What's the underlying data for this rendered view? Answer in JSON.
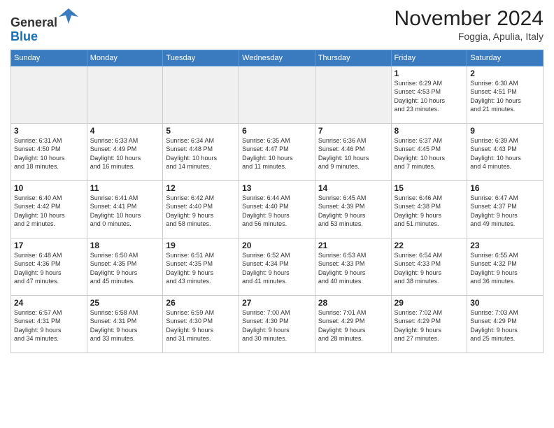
{
  "header": {
    "logo_line1": "General",
    "logo_line2": "Blue",
    "month_title": "November 2024",
    "location": "Foggia, Apulia, Italy"
  },
  "calendar": {
    "weekdays": [
      "Sunday",
      "Monday",
      "Tuesday",
      "Wednesday",
      "Thursday",
      "Friday",
      "Saturday"
    ],
    "weeks": [
      [
        {
          "day": "",
          "info": ""
        },
        {
          "day": "",
          "info": ""
        },
        {
          "day": "",
          "info": ""
        },
        {
          "day": "",
          "info": ""
        },
        {
          "day": "",
          "info": ""
        },
        {
          "day": "1",
          "info": "Sunrise: 6:29 AM\nSunset: 4:53 PM\nDaylight: 10 hours\nand 23 minutes."
        },
        {
          "day": "2",
          "info": "Sunrise: 6:30 AM\nSunset: 4:51 PM\nDaylight: 10 hours\nand 21 minutes."
        }
      ],
      [
        {
          "day": "3",
          "info": "Sunrise: 6:31 AM\nSunset: 4:50 PM\nDaylight: 10 hours\nand 18 minutes."
        },
        {
          "day": "4",
          "info": "Sunrise: 6:33 AM\nSunset: 4:49 PM\nDaylight: 10 hours\nand 16 minutes."
        },
        {
          "day": "5",
          "info": "Sunrise: 6:34 AM\nSunset: 4:48 PM\nDaylight: 10 hours\nand 14 minutes."
        },
        {
          "day": "6",
          "info": "Sunrise: 6:35 AM\nSunset: 4:47 PM\nDaylight: 10 hours\nand 11 minutes."
        },
        {
          "day": "7",
          "info": "Sunrise: 6:36 AM\nSunset: 4:46 PM\nDaylight: 10 hours\nand 9 minutes."
        },
        {
          "day": "8",
          "info": "Sunrise: 6:37 AM\nSunset: 4:45 PM\nDaylight: 10 hours\nand 7 minutes."
        },
        {
          "day": "9",
          "info": "Sunrise: 6:39 AM\nSunset: 4:43 PM\nDaylight: 10 hours\nand 4 minutes."
        }
      ],
      [
        {
          "day": "10",
          "info": "Sunrise: 6:40 AM\nSunset: 4:42 PM\nDaylight: 10 hours\nand 2 minutes."
        },
        {
          "day": "11",
          "info": "Sunrise: 6:41 AM\nSunset: 4:41 PM\nDaylight: 10 hours\nand 0 minutes."
        },
        {
          "day": "12",
          "info": "Sunrise: 6:42 AM\nSunset: 4:40 PM\nDaylight: 9 hours\nand 58 minutes."
        },
        {
          "day": "13",
          "info": "Sunrise: 6:44 AM\nSunset: 4:40 PM\nDaylight: 9 hours\nand 56 minutes."
        },
        {
          "day": "14",
          "info": "Sunrise: 6:45 AM\nSunset: 4:39 PM\nDaylight: 9 hours\nand 53 minutes."
        },
        {
          "day": "15",
          "info": "Sunrise: 6:46 AM\nSunset: 4:38 PM\nDaylight: 9 hours\nand 51 minutes."
        },
        {
          "day": "16",
          "info": "Sunrise: 6:47 AM\nSunset: 4:37 PM\nDaylight: 9 hours\nand 49 minutes."
        }
      ],
      [
        {
          "day": "17",
          "info": "Sunrise: 6:48 AM\nSunset: 4:36 PM\nDaylight: 9 hours\nand 47 minutes."
        },
        {
          "day": "18",
          "info": "Sunrise: 6:50 AM\nSunset: 4:35 PM\nDaylight: 9 hours\nand 45 minutes."
        },
        {
          "day": "19",
          "info": "Sunrise: 6:51 AM\nSunset: 4:35 PM\nDaylight: 9 hours\nand 43 minutes."
        },
        {
          "day": "20",
          "info": "Sunrise: 6:52 AM\nSunset: 4:34 PM\nDaylight: 9 hours\nand 41 minutes."
        },
        {
          "day": "21",
          "info": "Sunrise: 6:53 AM\nSunset: 4:33 PM\nDaylight: 9 hours\nand 40 minutes."
        },
        {
          "day": "22",
          "info": "Sunrise: 6:54 AM\nSunset: 4:33 PM\nDaylight: 9 hours\nand 38 minutes."
        },
        {
          "day": "23",
          "info": "Sunrise: 6:55 AM\nSunset: 4:32 PM\nDaylight: 9 hours\nand 36 minutes."
        }
      ],
      [
        {
          "day": "24",
          "info": "Sunrise: 6:57 AM\nSunset: 4:31 PM\nDaylight: 9 hours\nand 34 minutes."
        },
        {
          "day": "25",
          "info": "Sunrise: 6:58 AM\nSunset: 4:31 PM\nDaylight: 9 hours\nand 33 minutes."
        },
        {
          "day": "26",
          "info": "Sunrise: 6:59 AM\nSunset: 4:30 PM\nDaylight: 9 hours\nand 31 minutes."
        },
        {
          "day": "27",
          "info": "Sunrise: 7:00 AM\nSunset: 4:30 PM\nDaylight: 9 hours\nand 30 minutes."
        },
        {
          "day": "28",
          "info": "Sunrise: 7:01 AM\nSunset: 4:29 PM\nDaylight: 9 hours\nand 28 minutes."
        },
        {
          "day": "29",
          "info": "Sunrise: 7:02 AM\nSunset: 4:29 PM\nDaylight: 9 hours\nand 27 minutes."
        },
        {
          "day": "30",
          "info": "Sunrise: 7:03 AM\nSunset: 4:29 PM\nDaylight: 9 hours\nand 25 minutes."
        }
      ]
    ]
  }
}
